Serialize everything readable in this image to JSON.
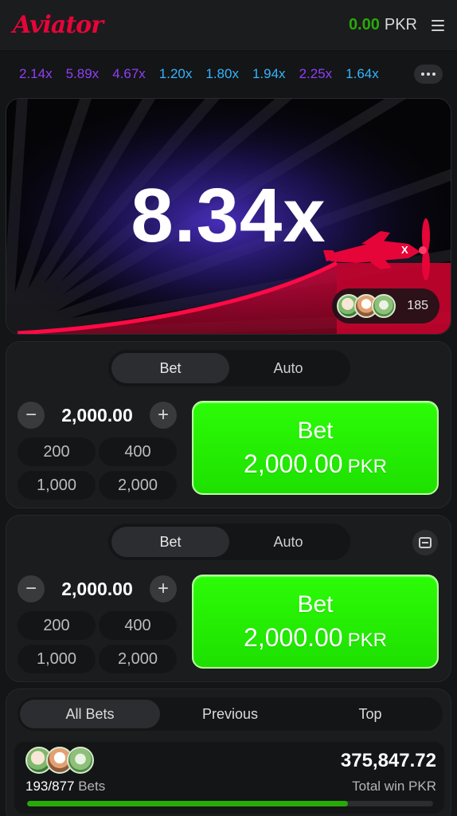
{
  "header": {
    "logo": "Aviator",
    "balance_amount": "0.00",
    "balance_currency": "PKR"
  },
  "history": [
    {
      "value": "2.14x",
      "color": "#913ef8"
    },
    {
      "value": "5.89x",
      "color": "#913ef8"
    },
    {
      "value": "4.67x",
      "color": "#913ef8"
    },
    {
      "value": "1.20x",
      "color": "#34b4ff"
    },
    {
      "value": "1.80x",
      "color": "#34b4ff"
    },
    {
      "value": "1.94x",
      "color": "#34b4ff"
    },
    {
      "value": "2.25x",
      "color": "#913ef8"
    },
    {
      "value": "1.64x",
      "color": "#34b4ff"
    }
  ],
  "game": {
    "multiplier": "8.34x",
    "players_count": "185",
    "accent_color": "#e50539"
  },
  "bet_panels": [
    {
      "tabs": [
        "Bet",
        "Auto"
      ],
      "active_tab": "Bet",
      "amount": "2,000.00",
      "quick_amounts": [
        "200",
        "400",
        "1,000",
        "2,000"
      ],
      "button_label": "Bet",
      "button_amount": "2,000.00",
      "button_currency": "PKR"
    },
    {
      "tabs": [
        "Bet",
        "Auto"
      ],
      "active_tab": "Bet",
      "amount": "2,000.00",
      "quick_amounts": [
        "200",
        "400",
        "1,000",
        "2,000"
      ],
      "button_label": "Bet",
      "button_amount": "2,000.00",
      "button_currency": "PKR"
    }
  ],
  "bets": {
    "tabs": [
      "All Bets",
      "Previous",
      "Top"
    ],
    "active_tab": "All Bets",
    "bets_count": "193/877",
    "bets_label": "Bets",
    "total_win": "375,847.72",
    "total_win_label": "Total win PKR",
    "progress": 0.79
  }
}
